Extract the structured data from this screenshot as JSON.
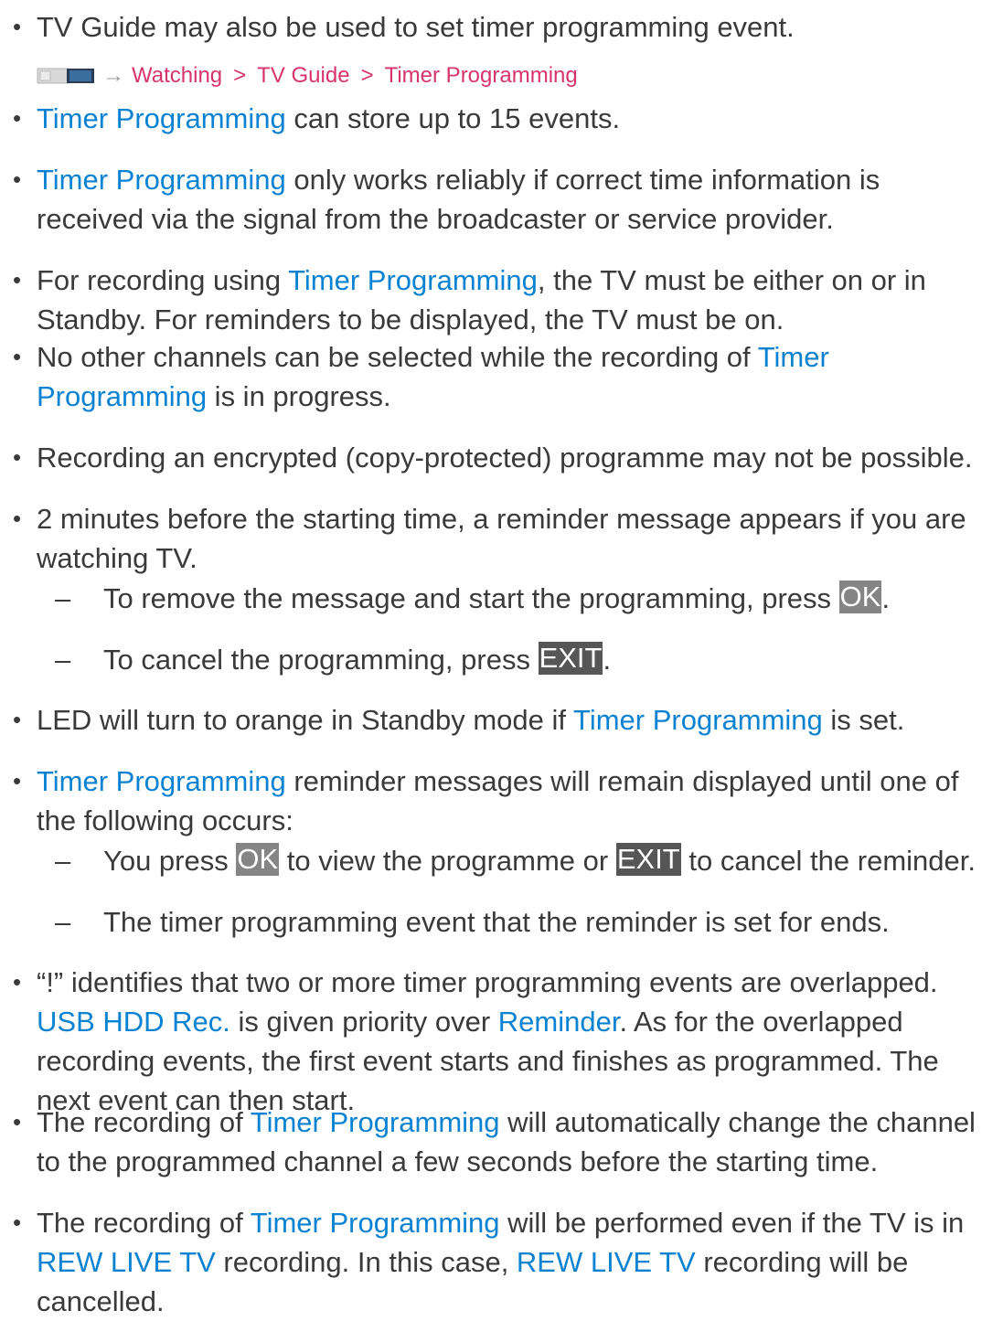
{
  "intro": {
    "text": "TV Guide may also be used to set timer programming event."
  },
  "breadcrumb": {
    "arrow": "→",
    "sep": ">",
    "items": [
      "Watching",
      "TV Guide",
      "Timer Programming"
    ]
  },
  "bullets": {
    "b1": {
      "link": "Timer Programming",
      "text": " can store up to 15 events."
    },
    "b2": {
      "link": "Timer Programming",
      "text": " only works reliably if correct time information is received via the signal from the broadcaster or service provider."
    },
    "b3": {
      "pre": "For recording using ",
      "link": "Timer Programming",
      "post": ", the TV must be either on or in Standby. For reminders to be displayed, the TV must be on."
    },
    "b4": {
      "pre": "No other channels can be selected while the recording of ",
      "link": "Timer Programming",
      "post": " is in progress."
    },
    "b5": {
      "text": "Recording an encrypted (copy-protected) programme may not be possible."
    },
    "b6": {
      "text": "2 minutes before the starting time, a reminder message appears if you are watching TV."
    },
    "b7": {
      "pre": "LED will turn to orange in Standby mode if ",
      "link": "Timer Programming",
      "post": " is set."
    },
    "b8": {
      "link": "Timer Programming",
      "text": " reminder messages will remain displayed until one of the following occurs:"
    },
    "b9": {
      "pre": "“!” identifies that two or more timer programming events are overlapped. ",
      "link1": "USB HDD Rec.",
      "mid": " is given priority over ",
      "link2": "Reminder",
      "post": ". As for the overlapped recording events, the first event starts and finishes as programmed. The next event can then start."
    },
    "b10": {
      "pre": "The recording of ",
      "link": "Timer Programming",
      "post": " will automatically change the channel to the programmed channel a few seconds before the starting time."
    },
    "b11": {
      "pre": "The recording of ",
      "link1": "Timer Programming",
      "mid1": " will be performed even if the TV is in ",
      "link2": "REW LIVE TV",
      "mid2": " recording. In this case, ",
      "link3": "REW LIVE TV",
      "post": " recording will be cancelled."
    }
  },
  "subitems": {
    "s1": {
      "pre": "To remove the message and start the programming, press ",
      "key": "OK",
      "post": "."
    },
    "s2": {
      "pre": "To cancel the programming, press ",
      "key": "EXIT",
      "post": "."
    },
    "s3": {
      "pre": "You press ",
      "key1": "OK",
      "mid": " to view the programme or ",
      "key2": "EXIT",
      "post": " to cancel the reminder."
    },
    "s4": {
      "text": "The timer programming event that the reminder is set for ends."
    }
  },
  "symbols": {
    "bullet": "•",
    "dash": "–"
  }
}
